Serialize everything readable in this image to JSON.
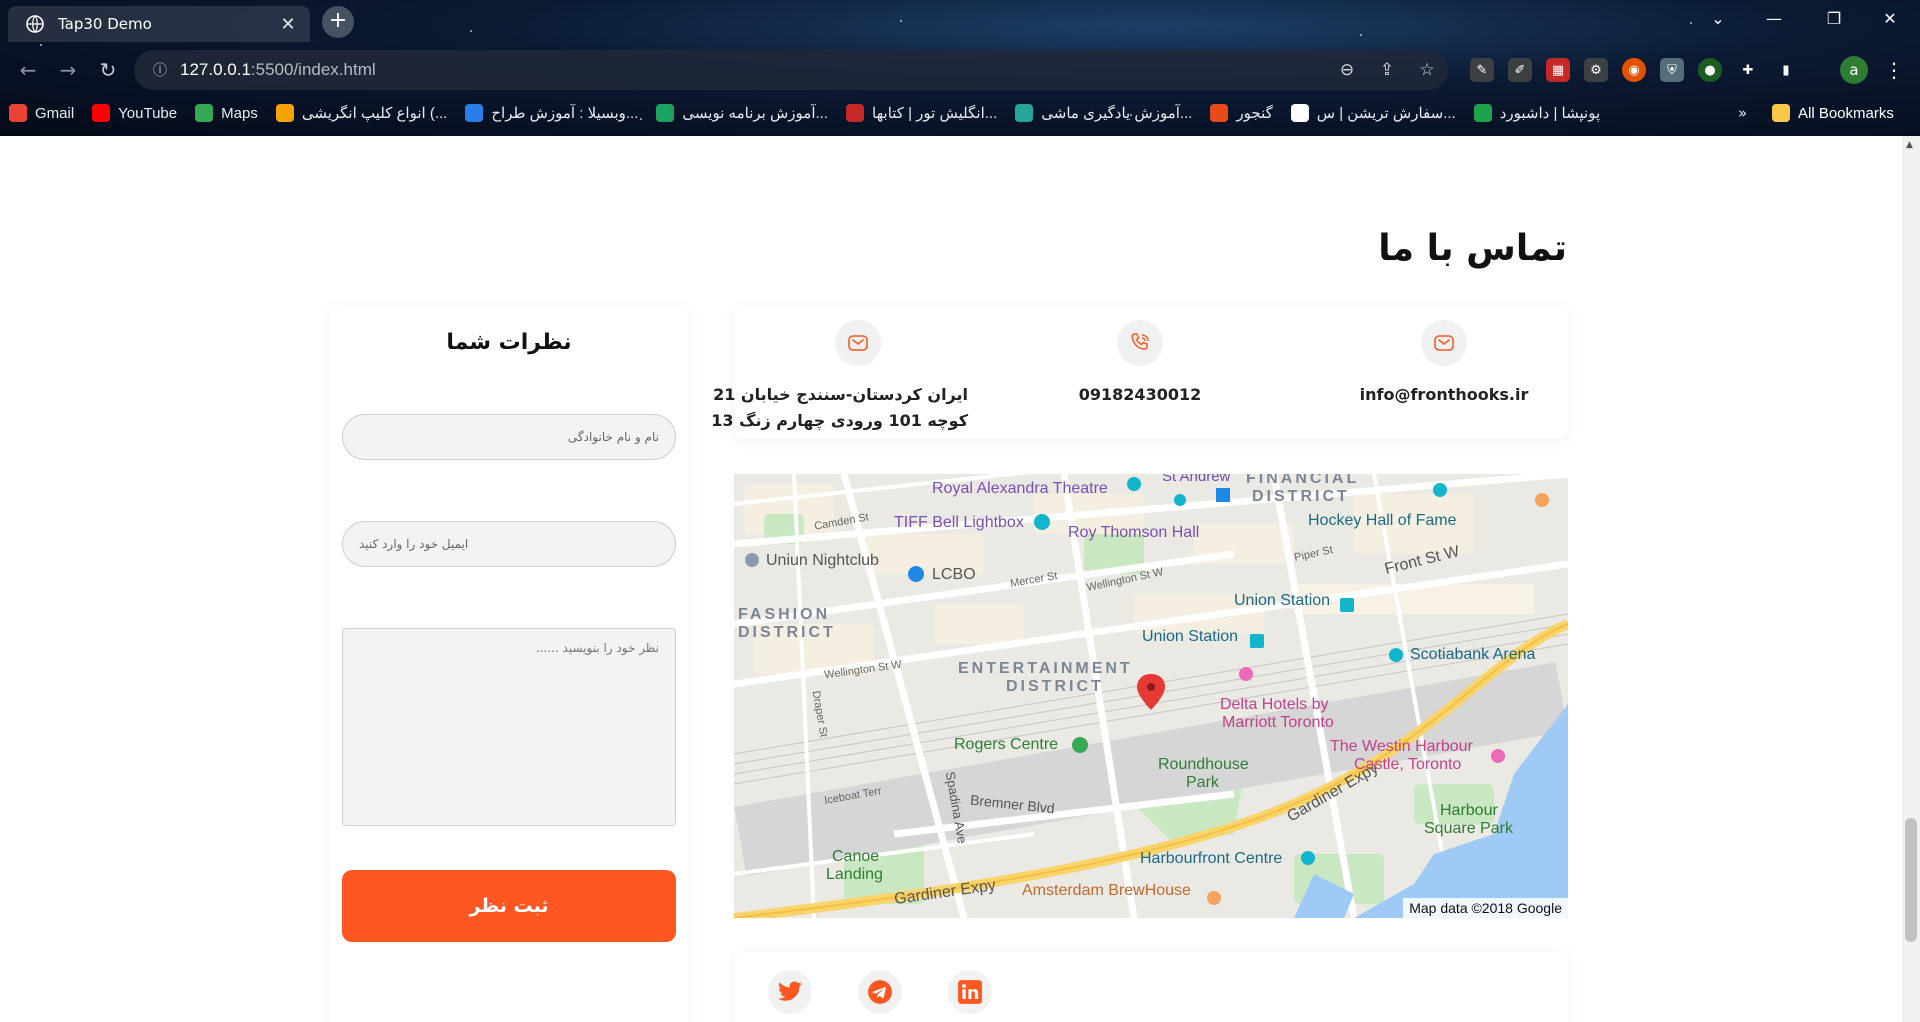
{
  "browser": {
    "tab_title": "Tap30 Demo",
    "tab_close": "✕",
    "new_tab": "+",
    "url_host": "127.0.0.1",
    "url_path": ":5500/index.html",
    "avatar_letter": "a",
    "bookmarks": [
      {
        "label": "Gmail",
        "icon": "gmail-icon",
        "color": "#ea4335"
      },
      {
        "label": "YouTube",
        "icon": "youtube-icon",
        "color": "#ff0000"
      },
      {
        "label": "Maps",
        "icon": "maps-icon",
        "color": "#34a853"
      },
      {
        "label": "انواع کلیپ انگریشی (...",
        "icon": "clip-icon",
        "color": "#f4a300"
      },
      {
        "label": "وبسیلا : آموزش طراح...",
        "icon": "websila-icon",
        "color": "#2b7de9"
      },
      {
        "label": "آموزش برنامه نویسی...",
        "icon": "check-icon",
        "color": "#1aa260"
      },
      {
        "label": "انگلیش تور | کتابها...",
        "icon": "englishtour-icon",
        "color": "#c62828"
      },
      {
        "label": "آموزش یادگیری ماشی...",
        "icon": "ml-icon",
        "color": "#26a69a"
      },
      {
        "label": "گنجور",
        "icon": "ganjoor-icon",
        "color": "#e64a19"
      },
      {
        "label": "سفارش تریشن | س...",
        "icon": "order-icon",
        "color": "#ffffff"
      },
      {
        "label": "پونیشا | داشبورد",
        "icon": "ponisha-icon",
        "color": "#1fa34a"
      }
    ],
    "all_bookmarks": "All Bookmarks"
  },
  "page": {
    "section_title": "تماس با ما",
    "comments": {
      "title": "نظرات شما",
      "name_placeholder": "نام و نام خانوادگی",
      "email_placeholder": "ایمیل خود را وارد کنید",
      "message_placeholder": "نظر خود را بنویسید ......",
      "submit_label": "ثبت نظر"
    },
    "contact": {
      "email": "info@fronthooks.ir",
      "phone": "09182430012",
      "address_line1": "ایران کردستان-سنندج خیابان 21",
      "address_line2": "کوچه 101 ورودی چهارم زنگ 13"
    },
    "map": {
      "labels": {
        "royal_alexandra": "Royal Alexandra Theatre",
        "st_andrew": "St Andrew",
        "financial": "FINANCIAL",
        "district": "DISTRICT",
        "tiff": "TIFF Bell Lightbox",
        "roy_thomson": "Roy Thomson Hall",
        "hockey": "Hockey Hall of Fame",
        "camden": "Camden St",
        "uniun": "Uniun Nightclub",
        "lcbo": "LCBO",
        "mercer": "Mercer St",
        "wellington_e": "Wellington St W",
        "piper": "Piper St",
        "front": "Front St W",
        "fashion": "FASHION",
        "fashion_district": "DISTRICT",
        "union1": "Union Station",
        "union2": "Union Station",
        "scotiabank": "Scotiabank Arena",
        "wellington_w": "Wellington St W",
        "entertainment": "ENTERTAINMENT",
        "ent_district": "DISTRICT",
        "draper": "Draper St",
        "delta1": "Delta Hotels by",
        "delta2": "Marriott Toronto",
        "rogers": "Rogers Centre",
        "roundhouse1": "Roundhouse",
        "roundhouse2": "Park",
        "westin1": "The Westin Harbour",
        "westin2": "Castle, Toronto",
        "iceboat": "Iceboat Terr",
        "spadina": "Spadina Ave",
        "bremner": "Bremner Blvd",
        "gardiner1": "Gardiner Expy",
        "gardiner2": "Gardiner Expy",
        "harbour_sq1": "Harbour",
        "harbour_sq2": "Square Park",
        "canoe1": "Canoe",
        "canoe2": "Landing",
        "harbourfront": "Harbourfront Centre",
        "amsterdam": "Amsterdam BrewHouse"
      },
      "copyright": "Map data ©2018 Google"
    },
    "social": [
      "twitter-icon",
      "telegram-icon",
      "linkedin-icon"
    ],
    "accent_color": "#ff5722"
  }
}
